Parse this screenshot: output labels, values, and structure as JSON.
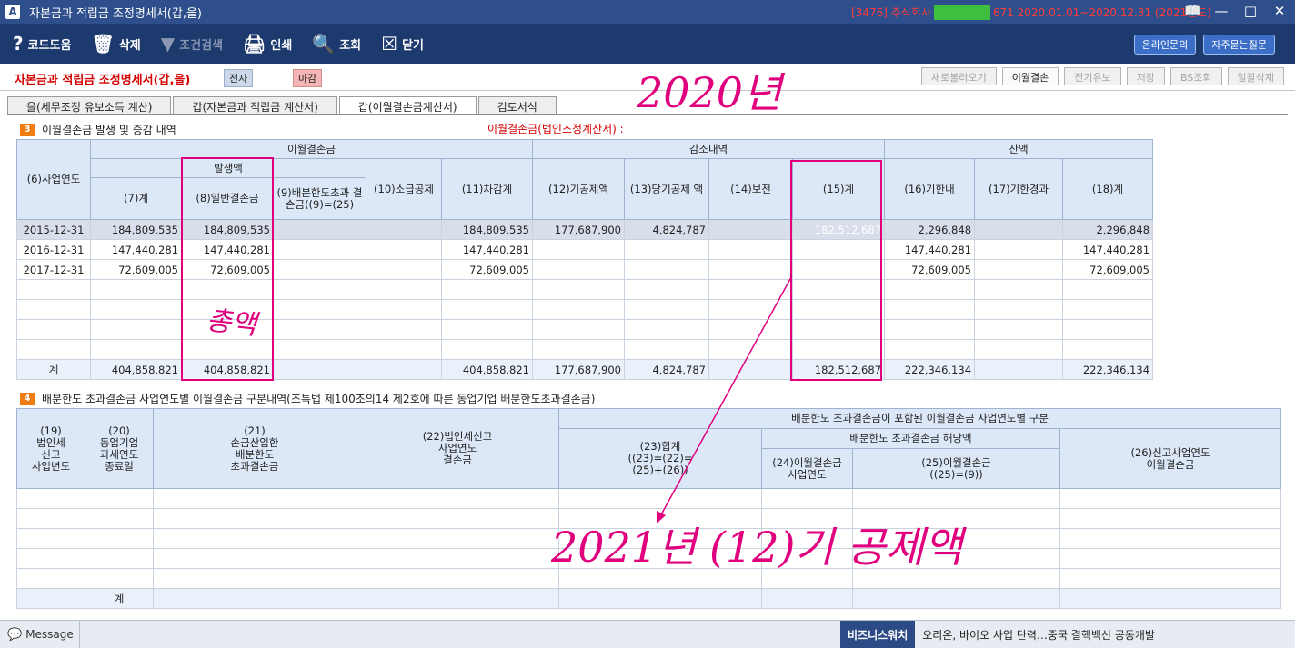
{
  "window": {
    "title": "자본금과 적립금 조정명세서(갑,을)",
    "company_prefix": "[3476] 주식회사",
    "company_suffix": "671 2020.01.01~2020.12.31 (2021년도)"
  },
  "toolbar": {
    "help": "코드도움",
    "delete": "삭제",
    "search_cond": "조건검색",
    "print": "인쇄",
    "query": "조회",
    "close": "닫기",
    "online_inquiry": "온라인문의",
    "faq": "자주묻는질문"
  },
  "form": {
    "title": "자본금과 적립금 조정명세서(갑,을)",
    "badge_e": "전자",
    "badge_m": "마감",
    "actions": [
      "새로불러오기",
      "이월결손",
      "전기유보",
      "저장",
      "BS조회",
      "일괄삭제"
    ]
  },
  "tabs": [
    "을(세무조정 유보소득 계산)",
    "갑(자본금과 적립금 계산서)",
    "갑(이월결손금계산서)",
    "검토서식"
  ],
  "section3": {
    "num": "3",
    "title": "이월결손금 발생 및 증감 내역",
    "note": "이월결손금(법인조정계산서) :",
    "h_group1": "이월결손금",
    "h_occur": "발생액",
    "h_decrease": "감소내역",
    "h_balance": "잔액",
    "cols": [
      "(6)사업연도",
      "(7)계",
      "(8)일반결손금",
      "(9)배분한도초과 결손금((9)=(25)",
      "(10)소급공제",
      "(11)차감계",
      "(12)기공제액",
      "(13)당기공제 액",
      "(14)보전",
      "(15)계",
      "(16)기한내",
      "(17)기한경과",
      "(18)계"
    ],
    "rows": [
      [
        "2015-12-31",
        "184,809,535",
        "184,809,535",
        "",
        "",
        "184,809,535",
        "177,687,900",
        "4,824,787",
        "",
        "182,512,687",
        "2,296,848",
        "",
        "2,296,848"
      ],
      [
        "2016-12-31",
        "147,440,281",
        "147,440,281",
        "",
        "",
        "147,440,281",
        "",
        "",
        "",
        "",
        "147,440,281",
        "",
        "147,440,281"
      ],
      [
        "2017-12-31",
        "72,609,005",
        "72,609,005",
        "",
        "",
        "72,609,005",
        "",
        "",
        "",
        "",
        "72,609,005",
        "",
        "72,609,005"
      ],
      [
        "",
        "",
        "",
        "",
        "",
        "",
        "",
        "",
        "",
        "",
        "",
        "",
        ""
      ],
      [
        "",
        "",
        "",
        "",
        "",
        "",
        "",
        "",
        "",
        "",
        "",
        "",
        ""
      ],
      [
        "",
        "",
        "",
        "",
        "",
        "",
        "",
        "",
        "",
        "",
        "",
        "",
        ""
      ],
      [
        "",
        "",
        "",
        "",
        "",
        "",
        "",
        "",
        "",
        "",
        "",
        "",
        ""
      ]
    ],
    "total": [
      "계",
      "404,858,821",
      "404,858,821",
      "",
      "",
      "404,858,821",
      "177,687,900",
      "4,824,787",
      "",
      "182,512,687",
      "222,346,134",
      "",
      "222,346,134"
    ]
  },
  "section4": {
    "num": "4",
    "title": "배분한도 초과결손금 사업연도별 이월결손금 구분내역(조특법 제100조의14 제2호에 따른 동업기업 배분한도초과결손금)",
    "h19": "(19)\n법인세\n신고\n사업년도",
    "h20": "(20)\n동업기업\n과세연도\n종료일",
    "h21": "(21)\n손금산입한\n배분한도\n초과결손금",
    "h22": "(22)법인세신고\n사업연도\n결손금",
    "h_group": "배분한도 초과결손금이 포함된 이월결손금 사업연도별 구분",
    "h23": "(23)합계\n((23)=(22)=\n(25)+(26))",
    "h_sub": "배분한도 초과결손금 해당액",
    "h24": "(24)이월결손금\n사업연도",
    "h25": "(25)이월결손금\n((25)=(9))",
    "h26": "(26)신고사업연도\n이월결손금",
    "total_label": "계"
  },
  "annotations": {
    "year": "2020년",
    "amount": "총액",
    "note": "2021년 (12)기 공제액",
    "color": "#e0007e"
  },
  "statusbar": {
    "message": "Message",
    "news_label": "비즈니스워치",
    "news_text": "오리온, 바이오 사업 탄력…중국 결핵백신 공동개발"
  }
}
